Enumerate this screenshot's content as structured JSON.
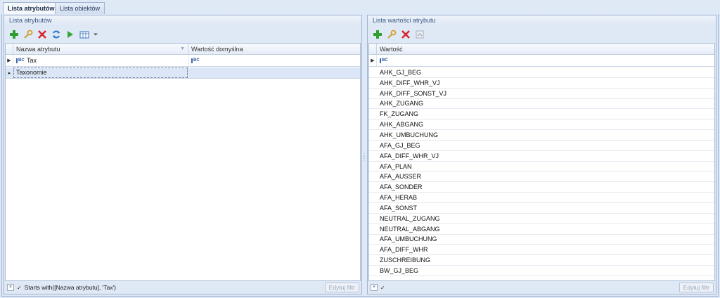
{
  "tabs": [
    {
      "label": "Lista atrybutów",
      "active": true
    },
    {
      "label": "Lista obiektów",
      "active": false
    }
  ],
  "left_panel": {
    "title": "Lista atrybutów",
    "toolbar": {
      "icons": [
        "add-icon",
        "edit-icon",
        "delete-icon",
        "refresh-icon",
        "run-icon",
        "grid-view-icon",
        "dropdown-arrow-icon"
      ]
    },
    "columns": [
      "Nazwa atrybutu",
      "Wartość domyślna"
    ],
    "filter_row": {
      "name_value": "Tax",
      "default_value": ""
    },
    "group_row": {
      "label": "Taxonomie"
    },
    "status": {
      "filter_text": "Starts with([Nazwa atrybutu], 'Tax')",
      "edit_filter_label": "Edytuj filtr"
    }
  },
  "right_panel": {
    "title": "Lista wartości atrybutu",
    "toolbar": {
      "icons": [
        "add-icon",
        "edit-icon",
        "delete-icon",
        "import-icon"
      ]
    },
    "columns": [
      "Wartość"
    ],
    "filter_row": {
      "value": ""
    },
    "rows": [
      "AHK_GJ_BEG",
      "AHK_DIFF_WHR_VJ",
      "AHK_DIFF_SONST_VJ",
      "AHK_ZUGANG",
      "FK_ZUGANG",
      "AHK_ABGANG",
      "AHK_UMBUCHUNG",
      "AFA_GJ_BEG",
      "AFA_DIFF_WHR_VJ",
      "AFA_PLAN",
      "AFA_AUSSER",
      "AFA_SONDER",
      "AFA_HERAB",
      "AFA_SONST",
      "NEUTRAL_ZUGANG",
      "NEUTRAL_ABGANG",
      "AFA_UMBUCHUNG",
      "AFA_DIFF_WHR",
      "ZUSCHREIBUNG",
      "BW_GJ_BEG"
    ],
    "status": {
      "filter_text": "",
      "edit_filter_label": "Edytuj filtr"
    }
  },
  "colors": {
    "add": "#2f9e2f",
    "delete": "#d9232d",
    "edit": "#d8a12a",
    "refresh": "#2a78c8"
  }
}
